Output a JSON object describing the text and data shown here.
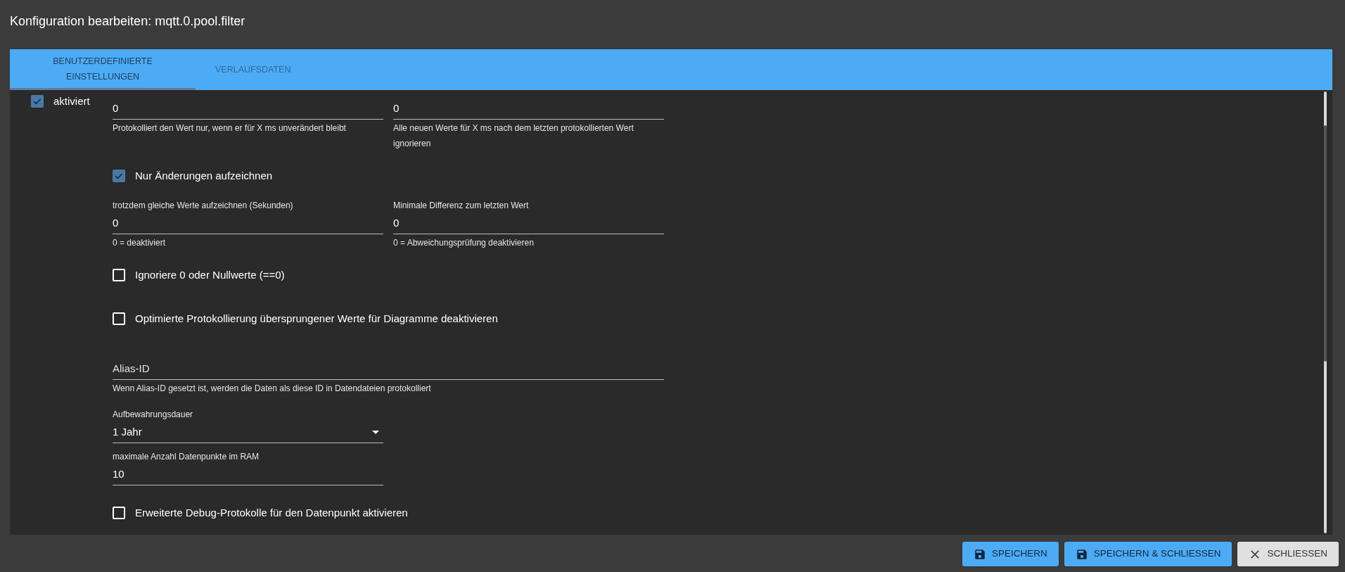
{
  "title": "Konfiguration bearbeiten: mqtt.0.pool.filter",
  "tabs": [
    {
      "label": "BENUTZERDEFINIERTE EINSTELLUNGEN",
      "selected": true
    },
    {
      "label": "VERLAUFSDATEN",
      "selected": false
    }
  ],
  "enabled": {
    "label": "aktiviert",
    "checked": true
  },
  "items": [
    {
      "kind": "field_pair",
      "fields": [
        {
          "value": "0",
          "helper": "Protokolliert den Wert nur, wenn er für X ms unverändert bleibt"
        },
        {
          "value": "0",
          "helper": "Alle neuen Werte für X ms nach dem letzten protokollierten Wert ignorieren"
        }
      ]
    },
    {
      "kind": "checkbox",
      "label": "Nur Änderungen aufzeichnen",
      "checked": true
    },
    {
      "kind": "field_pair",
      "fields": [
        {
          "label": "trotzdem gleiche Werte aufzeichnen (Sekunden)",
          "value": "0",
          "helper": "0 = deaktiviert"
        },
        {
          "label": "Minimale Differenz zum letzten Wert",
          "value": "0",
          "helper": "0 = Abweichungsprüfung deaktivieren"
        }
      ]
    },
    {
      "kind": "checkbox",
      "label": "Ignoriere 0 oder Nullwerte (==0)",
      "checked": false
    },
    {
      "kind": "checkbox",
      "label": "Optimierte Protokollierung übersprungener Werte für Diagramme deaktivieren",
      "checked": false
    },
    {
      "kind": "text_field",
      "placeholder": "Alias-ID",
      "helper": "Wenn Alias-ID gesetzt ist, werden die Daten als diese ID in Datendateien protokolliert"
    },
    {
      "kind": "select",
      "label": "Aufbewahrungsdauer",
      "value": "1 Jahr"
    },
    {
      "kind": "text_field",
      "label": "maximale Anzahl Datenpunkte im RAM",
      "value": "10"
    },
    {
      "kind": "checkbox",
      "label": "Erweiterte Debug-Protokolle für den Datenpunkt aktivieren",
      "checked": false
    }
  ],
  "buttons": [
    {
      "label": "SPEICHERN",
      "kind": "primary"
    },
    {
      "label": "SPEICHERN & SCHLIESSEN",
      "kind": "primary"
    },
    {
      "label": "SCHLIESSEN",
      "kind": "secondary"
    }
  ]
}
